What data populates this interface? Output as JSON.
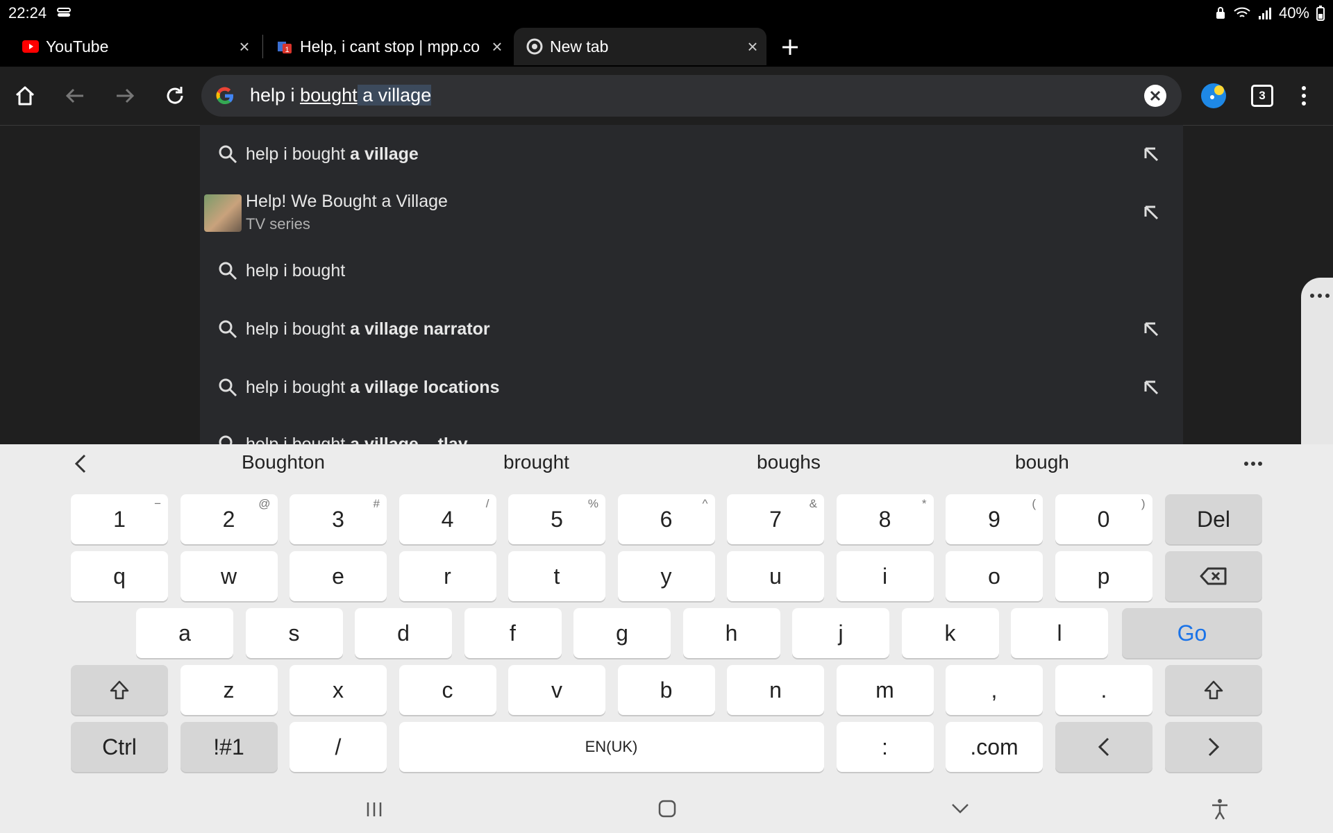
{
  "status_bar": {
    "time": "22:24",
    "battery": "40%"
  },
  "tabs": [
    {
      "label": "YouTube"
    },
    {
      "label": "Help, i cant stop | mpp.co"
    },
    {
      "label": "New tab"
    }
  ],
  "omnibox": {
    "text_prefix": "help i ",
    "text_underlined": "bought",
    "text_selected": " a village"
  },
  "tab_count": "3",
  "suggestions": [
    {
      "plain": "help i bought ",
      "bold": "a village"
    },
    {
      "title": "Help! We Bought a Village",
      "subtitle": "TV series"
    },
    {
      "plain": "help i bought",
      "bold": ""
    },
    {
      "plain": "help i bought ",
      "bold": "a village narrator"
    },
    {
      "plain": "help i bought ",
      "bold": "a village locations"
    },
    {
      "plain": "help i bought ",
      "bold": "a village ...tlay"
    }
  ],
  "predictions": [
    "Boughton",
    "brought",
    "boughs",
    "bough"
  ],
  "keyboard": {
    "row1": [
      [
        "1",
        "−"
      ],
      [
        "2",
        "@"
      ],
      [
        "3",
        "#"
      ],
      [
        "4",
        "/"
      ],
      [
        "5",
        "%"
      ],
      [
        "6",
        "^"
      ],
      [
        "7",
        "&"
      ],
      [
        "8",
        "*"
      ],
      [
        "9",
        "("
      ],
      [
        "0",
        ")"
      ]
    ],
    "del": "Del",
    "row2": [
      "q",
      "w",
      "e",
      "r",
      "t",
      "y",
      "u",
      "i",
      "o",
      "p"
    ],
    "row3": [
      "a",
      "s",
      "d",
      "f",
      "g",
      "h",
      "j",
      "k",
      "l"
    ],
    "go": "Go",
    "row4": [
      "z",
      "x",
      "c",
      "v",
      "b",
      "n",
      "m"
    ],
    "comma": ",",
    "period": ".",
    "ctrl": "Ctrl",
    "sym": "!#1",
    "slash": "/",
    "space": "EN(UK)",
    "colon": ":",
    "dotcom": ".com"
  },
  "colors": {
    "accent": "#1a73e8",
    "background": "#1f1f1f",
    "keyboard": "#ececec"
  }
}
